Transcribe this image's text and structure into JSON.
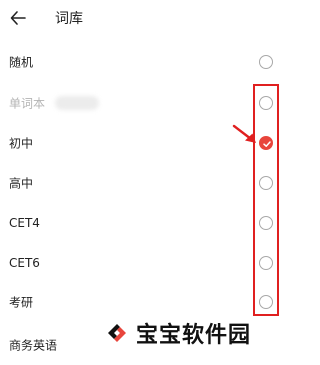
{
  "header": {
    "title": "词库"
  },
  "options": [
    {
      "label": "随机",
      "muted": false,
      "checked": false
    },
    {
      "label": "单词本",
      "muted": true,
      "checked": false
    },
    {
      "label": "初中",
      "muted": false,
      "checked": true
    },
    {
      "label": "高中",
      "muted": false,
      "checked": false
    },
    {
      "label": "CET4",
      "muted": false,
      "checked": false
    },
    {
      "label": "CET6",
      "muted": false,
      "checked": false
    },
    {
      "label": "考研",
      "muted": false,
      "checked": false
    },
    {
      "label": "商务英语",
      "muted": false,
      "checked": false
    }
  ],
  "watermark": {
    "text": "宝宝软件园"
  },
  "colors": {
    "accent": "#e8453c",
    "annotation": "#e02020",
    "muted_text": "#b4b4b4"
  }
}
